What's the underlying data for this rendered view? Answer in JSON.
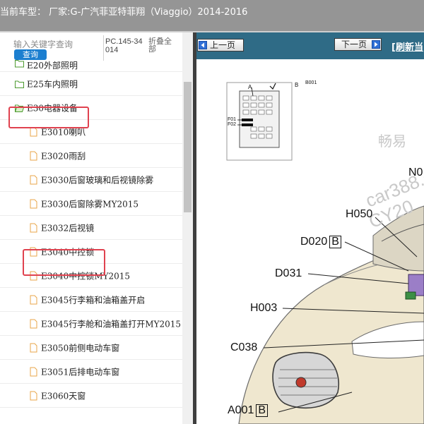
{
  "header": {
    "title": "当前车型：  厂家:G-广汽菲亚特菲翔（Viaggio）2014-2016"
  },
  "sidebar": {
    "search_placeholder": "输入关键字查询",
    "search_button": "查询",
    "code": "PC.145-34014",
    "fold_all": "折叠全部",
    "items": [
      {
        "label": "E20外部照明",
        "type": "folder"
      },
      {
        "label": "E25车内照明",
        "type": "folder"
      },
      {
        "label": "E30电器设备",
        "type": "folder-open"
      },
      {
        "label": "E3010喇叭",
        "type": "doc"
      },
      {
        "label": "E3020雨刮",
        "type": "doc"
      },
      {
        "label": "E3030后窗玻璃和后视镜除雾",
        "type": "doc"
      },
      {
        "label": "E3030后窗除雾MY2015",
        "type": "doc"
      },
      {
        "label": "E3032后视镜",
        "type": "doc"
      },
      {
        "label": "E3040中控锁",
        "type": "doc"
      },
      {
        "label": "E3040中控锁MY2015",
        "type": "doc"
      },
      {
        "label": "E3045行李箱和油箱盖开启",
        "type": "doc"
      },
      {
        "label": "E3045行李舱和油箱盖打开MY2015",
        "type": "doc"
      },
      {
        "label": "E3050前侧电动车窗",
        "type": "doc"
      },
      {
        "label": "E3051后排电动车窗",
        "type": "doc"
      },
      {
        "label": "E3060天窗",
        "type": "doc"
      }
    ]
  },
  "viewer": {
    "prev_button": "上一页",
    "next_button": "下一页",
    "refresh_link": "[刷新当"
  },
  "diagram": {
    "fuse_labels": {
      "a": "A",
      "b": "B",
      "code": "B001",
      "f01": "F01",
      "f02": "F02"
    },
    "callouts": {
      "n0": "N0",
      "h050": "H050",
      "d020": "D020",
      "d020_box": "B",
      "d031": "D031",
      "h003": "H003",
      "c038": "C038",
      "a001": "A001",
      "a001_box": "B"
    },
    "watermark": {
      "line1": "畅易",
      "line2": "car388.c",
      "line3": "CY20"
    }
  },
  "colors": {
    "topbar": "#959595",
    "splitter": "#3e3e3e",
    "navbar": "#2f6b86",
    "highlight": "#e0424f",
    "search_button": "#1c7fd0",
    "folder_icon": "#4c9a2f",
    "doc_icon": "#e8a64a"
  }
}
